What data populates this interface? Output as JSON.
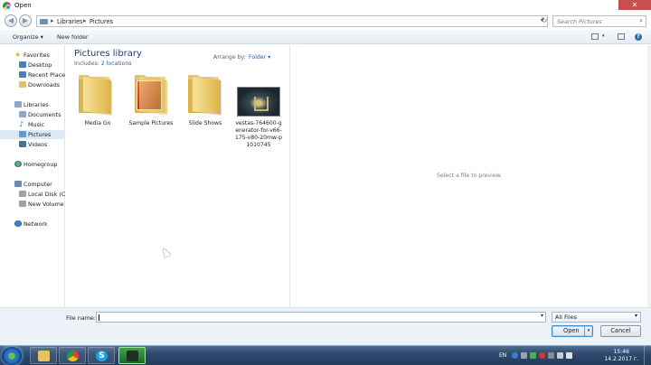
{
  "window": {
    "title": "Open",
    "close_glyph": "✕"
  },
  "address_bar": {
    "crumbs": [
      "Libraries",
      "Pictures"
    ],
    "separator": "▸",
    "dropdown": "▾",
    "refresh_glyph": "↻"
  },
  "search": {
    "placeholder": "Search Pictures",
    "icon": "search-icon"
  },
  "nav_buttons": {
    "back": "◀",
    "forward": "▶"
  },
  "toolbar": {
    "organize": "Organize ▾",
    "new_folder": "New folder",
    "view_drop": "▾",
    "help": "?"
  },
  "navigation": {
    "items": [
      {
        "label": "Favorites",
        "icon": "star-icon"
      },
      {
        "label": "Desktop",
        "icon": "desktop-icon"
      },
      {
        "label": "Recent Places",
        "icon": "recent-places-icon"
      },
      {
        "label": "Downloads",
        "icon": "downloads-icon"
      },
      {
        "label": "Libraries",
        "icon": "libraries-icon"
      },
      {
        "label": "Documents",
        "icon": "documents-icon"
      },
      {
        "label": "Music",
        "icon": "music-icon"
      },
      {
        "label": "Pictures",
        "icon": "pictures-icon",
        "selected": true
      },
      {
        "label": "Videos",
        "icon": "videos-icon"
      },
      {
        "label": "Homegroup",
        "icon": "homegroup-icon"
      },
      {
        "label": "Computer",
        "icon": "computer-icon"
      },
      {
        "label": "Local Disk (C:)",
        "icon": "disk-icon"
      },
      {
        "label": "New Volume (",
        "icon": "disk-icon"
      },
      {
        "label": "Network",
        "icon": "network-icon"
      }
    ]
  },
  "library": {
    "title": "Pictures library",
    "includes_prefix": "Includes:",
    "includes_link": "2 locations",
    "arrange_label": "Arrange by:",
    "arrange_value": "Folder ▾"
  },
  "files": [
    {
      "name": "Media Go",
      "kind": "folder"
    },
    {
      "name": "Sample Pictures",
      "kind": "folder-with-picture"
    },
    {
      "name": "Slide Shows",
      "kind": "folder"
    },
    {
      "name": "vestas-764600-generator-for-v66-175-v80-20mw-p1010745",
      "kind": "image"
    }
  ],
  "preview": {
    "message": "Select a file to preview."
  },
  "bottom": {
    "file_name_label": "File name:",
    "file_name_value": "",
    "file_type": "All Files",
    "open_label": "Open",
    "cancel_label": "Cancel",
    "dropdown": "▾"
  },
  "taskbar": {
    "language": "EN",
    "time": "15:46",
    "date": "14.2.2017 г."
  }
}
